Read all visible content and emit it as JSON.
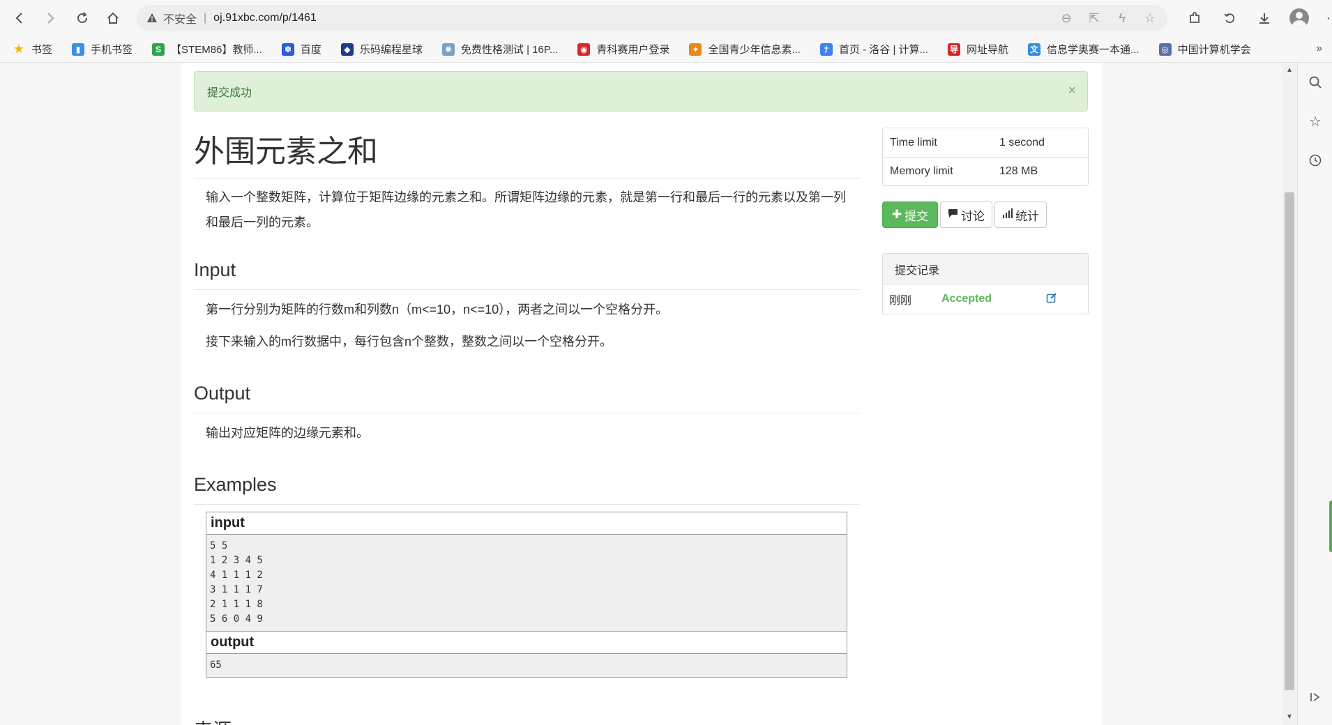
{
  "browser": {
    "insecure_label": "不安全",
    "url": "oj.91xbc.com/p/1461",
    "icons": {
      "back": "back-arrow-icon",
      "forward": "forward-arrow-icon",
      "reload": "reload-icon",
      "home": "home-icon",
      "warning": "warning-triangle-icon",
      "zoom": "zoom-out-icon",
      "share": "share-icon",
      "lightning": "lightning-icon",
      "star": "star-icon",
      "extensions": "extensions-icon",
      "history": "history-icon",
      "download": "download-icon",
      "profile": "profile-avatar-icon",
      "menu": "menu-dots-icon"
    }
  },
  "bookmarks": [
    {
      "label": "书签",
      "color": "#f5b800",
      "glyph": "★"
    },
    {
      "label": "手机书签",
      "color": "#3b8fe6",
      "glyph": "▮"
    },
    {
      "label": "【STEM86】教师...",
      "color": "#2ea44f",
      "glyph": "S"
    },
    {
      "label": "百度",
      "color": "#2b5bd7",
      "glyph": "✽"
    },
    {
      "label": "乐码编程星球",
      "color": "#1e3a8a",
      "glyph": "◆"
    },
    {
      "label": "免费性格测试 | 16P...",
      "color": "#7aa0c8",
      "glyph": "✺"
    },
    {
      "label": "青科赛用户登录",
      "color": "#d62828",
      "glyph": "◉"
    },
    {
      "label": "全国青少年信息素...",
      "color": "#e88a1a",
      "glyph": "✦"
    },
    {
      "label": "首页 - 洛谷 | 计算...",
      "color": "#3b82f6",
      "glyph": "ﾅ"
    },
    {
      "label": "网址导航",
      "color": "#d62828",
      "glyph": "导"
    },
    {
      "label": "信息学奥赛一本通...",
      "color": "#2f8fe0",
      "glyph": "文"
    },
    {
      "label": "中国计算机学会",
      "color": "#5b6fa8",
      "glyph": "◎"
    }
  ],
  "bookmarks_more": "»",
  "alert": {
    "text": "提交成功",
    "close": "×"
  },
  "problem": {
    "title": "外围元素之和",
    "description": "输入一个整数矩阵，计算位于矩阵边缘的元素之和。所谓矩阵边缘的元素，就是第一行和最后一行的元素以及第一列和最后一列的元素。",
    "input_heading": "Input",
    "input_text_1": "第一行分别为矩阵的行数m和列数n（m<=10，n<=10），两者之间以一个空格分开。",
    "input_text_2": "接下来输入的m行数据中，每行包含n个整数，整数之间以一个空格分开。",
    "output_heading": "Output",
    "output_text": "输出对应矩阵的边缘元素和。",
    "examples_heading": "Examples",
    "example_input_label": "input",
    "example_input": "5 5\n1 2 3 4 5\n4 1 1 1 2\n3 1 1 1 7\n2 1 1 1 8\n5 6 0 4 9",
    "example_output_label": "output",
    "example_output": "65",
    "next_heading_partial": "来源"
  },
  "limits": [
    {
      "key": "Time limit",
      "value": "1 second"
    },
    {
      "key": "Memory limit",
      "value": "128 MB"
    }
  ],
  "actions": {
    "submit_label": "提交",
    "submit_glyph": "✚",
    "discuss_label": "讨论",
    "discuss_icon": "comment-icon",
    "stats_label": "统计",
    "stats_icon": "bar-chart-icon"
  },
  "records": {
    "heading": "提交记录",
    "rows": [
      {
        "time": "刚刚",
        "status": "Accepted",
        "edit_icon": "edit-icon"
      }
    ]
  },
  "sidebar": {
    "search_icon": "search-icon",
    "star_icon": "star-icon",
    "history_icon": "clock-icon",
    "collapse_icon": "collapse-sidebar-icon"
  },
  "colors": {
    "accepted": "#5cb85c",
    "alert_bg": "#dff0d8",
    "alert_text": "#3c763d",
    "submit_bg": "#5cb85c"
  }
}
